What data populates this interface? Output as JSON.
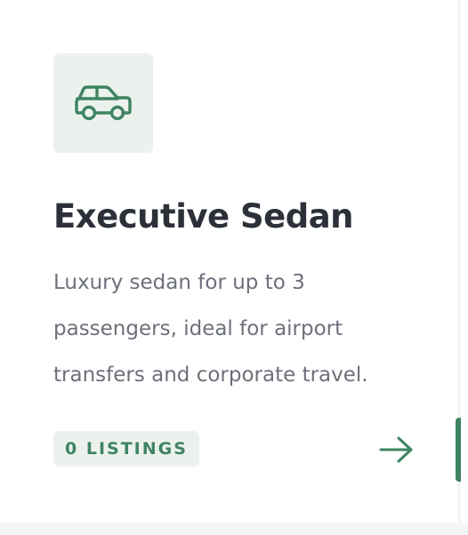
{
  "card": {
    "icon": "car-icon",
    "title": "Executive Sedan",
    "description": "Luxury sedan for up to 3 passengers, ideal for airport transfers and corporate travel.",
    "badge": "0 LISTINGS",
    "arrow_icon": "arrow-right-icon"
  },
  "colors": {
    "accent": "#3f8462",
    "tile_background": "#ebf2ee",
    "title": "#2c3039",
    "body_text": "#6c707a"
  }
}
